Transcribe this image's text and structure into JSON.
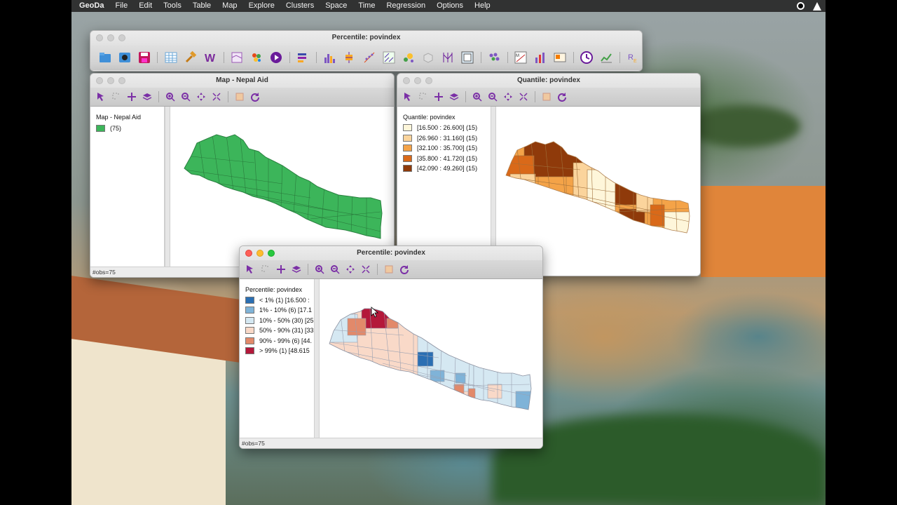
{
  "menubar": {
    "app": "GeoDa",
    "items": [
      "File",
      "Edit",
      "Tools",
      "Table",
      "Map",
      "Explore",
      "Clusters",
      "Space",
      "Time",
      "Regression",
      "Options",
      "Help"
    ]
  },
  "main_window": {
    "title": "Percentile: povindex"
  },
  "win_nepal": {
    "title": "Map - Nepal Aid",
    "legend_title": "Map - Nepal Aid",
    "categories": [
      {
        "label": "(75)",
        "color": "#3cb55a"
      }
    ],
    "status": "#obs=75"
  },
  "win_quantile": {
    "title": "Quantile: povindex",
    "legend_title": "Quantile: povindex",
    "categories": [
      {
        "label": "[16.500 : 26.600] (15)",
        "color": "#fef6da"
      },
      {
        "label": "[26.960 : 31.160] (15)",
        "color": "#fbd49c"
      },
      {
        "label": "[32.100 : 35.700] (15)",
        "color": "#f4a348"
      },
      {
        "label": "[35.800 : 41.720] (15)",
        "color": "#d96919"
      },
      {
        "label": "[42.090 : 49.260] (15)",
        "color": "#8f3a0a"
      }
    ]
  },
  "win_percentile": {
    "title": "Percentile: povindex",
    "legend_title": "Percentile: povindex",
    "categories": [
      {
        "label": "< 1% (1)  [16.500 :",
        "color": "#2b6fb3"
      },
      {
        "label": "1% - 10% (6)  [17.1",
        "color": "#7fb3d8"
      },
      {
        "label": "10% - 50% (30)  [25",
        "color": "#d5e8f2"
      },
      {
        "label": "50% - 90% (31)  [33",
        "color": "#f9d9c8"
      },
      {
        "label": "90% - 99% (6)  [44.",
        "color": "#e2896a"
      },
      {
        "label": "> 99% (1)  [48.615",
        "color": "#b4183a"
      }
    ],
    "status": "#obs=75"
  }
}
